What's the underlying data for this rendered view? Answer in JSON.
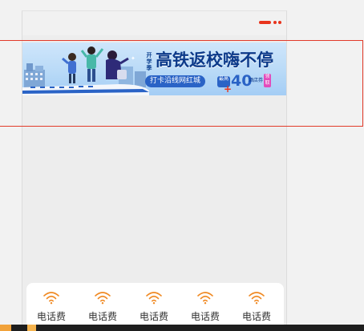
{
  "colors": {
    "accent": "#e8341c",
    "service_icon": "#f08a24",
    "banner_blue": "#0c3a8a",
    "highlight": "#e23b2a"
  },
  "header": {
    "more_icon": "more-dots-icon"
  },
  "banner": {
    "kicker": "开学季",
    "headline": "高铁返校嗨不停",
    "pill": "打卡沿线网红城",
    "coupon_max": "最高",
    "coupon_amount": "40",
    "coupon_unit": "酒店券",
    "badge": "领取"
  },
  "services": [
    {
      "label": "电话费",
      "icon": "wifi-signal-icon"
    },
    {
      "label": "电话费",
      "icon": "wifi-signal-icon"
    },
    {
      "label": "电话费",
      "icon": "wifi-signal-icon"
    },
    {
      "label": "电话费",
      "icon": "wifi-signal-icon"
    },
    {
      "label": "电话费",
      "icon": "wifi-signal-icon"
    }
  ]
}
